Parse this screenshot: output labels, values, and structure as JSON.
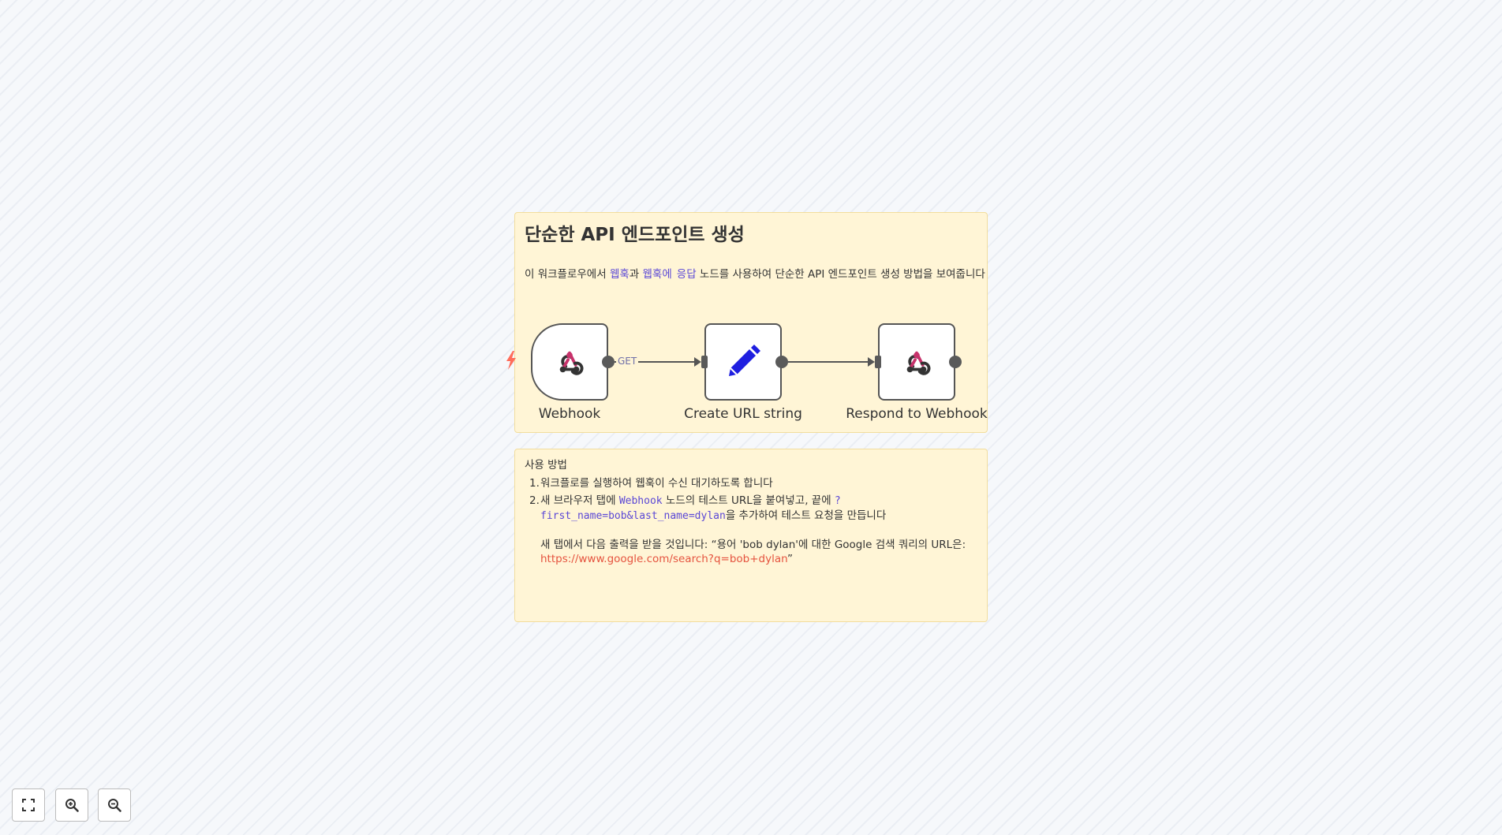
{
  "note_main": {
    "title": "단순한 API 엔드포인트 생성",
    "desc_pre": "이 워크플로우에서 ",
    "link_webhook": "웹훅",
    "desc_and": "과 ",
    "link_respond_1": "웹훅에",
    "link_respond_2": "응답",
    "desc_post": " 노드를 사용하여 단순한 API 엔드포인트 생성 방법을 보여줍니다"
  },
  "nodes": [
    {
      "label": "Webhook",
      "icon": "webhook-icon"
    },
    {
      "label": "Create URL string",
      "icon": "pencil-icon"
    },
    {
      "label": "Respond to Webhook",
      "icon": "webhook-icon"
    }
  ],
  "edges": {
    "webhook_to_create_label": "GET"
  },
  "note_usage": {
    "heading": "사용 방법",
    "step1": "워크플로를 실행하여 웹훅이 수신 대기하도록 합니다",
    "step2_pre": "새 브라우저 탭에 ",
    "step2_code": "Webhook",
    "step2_mid": " 노드의 테스트 URL을 붙여넣고, 끝에 ",
    "step2_code2a": "?",
    "step2_code2b": "first_name=bob&last_name=dylan",
    "step2_post": "을 추가하여 테스트 요청을 만듭니다",
    "result_pre": "새 탭에서 다음 출력을 받을 것입니다: “용어 'bob dylan'에 대한 Google 검색 쿼리의 URL은:",
    "result_link": "https://www.google.com/search?q=bob+dylan",
    "result_post": "”"
  },
  "colors": {
    "accent": "#5b48d6",
    "trigger": "#ff6d5a",
    "link_red": "#e5533f",
    "sticky": "#fff5d6",
    "pencil": "#1f1fe0"
  },
  "controls": {
    "fit": "fullscreen-icon",
    "zoom_in": "zoom-in-icon",
    "zoom_out": "zoom-out-icon"
  }
}
